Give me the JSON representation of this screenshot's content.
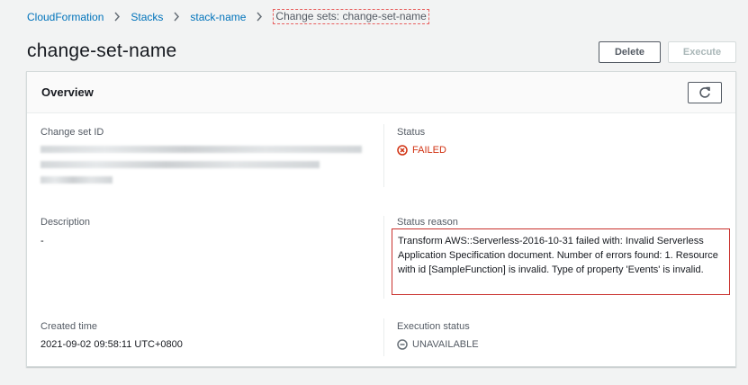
{
  "breadcrumb": {
    "items": [
      "CloudFormation",
      "Stacks",
      "stack-name"
    ],
    "current": "Change sets: change-set-name"
  },
  "header": {
    "title": "change-set-name",
    "delete_label": "Delete",
    "execute_label": "Execute"
  },
  "overview": {
    "title": "Overview",
    "change_set_id_label": "Change set ID",
    "status_label": "Status",
    "status_value": "FAILED",
    "description_label": "Description",
    "description_value": "-",
    "status_reason_label": "Status reason",
    "status_reason_value": "Transform AWS::Serverless-2016-10-31 failed with: Invalid Serverless Application Specification document. Number of errors found: 1. Resource with id [SampleFunction] is invalid. Type of property 'Events' is invalid.",
    "created_time_label": "Created time",
    "created_time_value": "2021-09-02 09:58:11 UTC+0800",
    "execution_status_label": "Execution status",
    "execution_status_value": "UNAVAILABLE"
  },
  "colors": {
    "link": "#0073bb",
    "failed": "#d13212",
    "highlight_border": "#c9302c",
    "background": "#f2f3f3"
  },
  "icons": [
    "chevron-right-icon",
    "refresh-icon",
    "error-circle-icon",
    "unavailable-circle-icon"
  ]
}
